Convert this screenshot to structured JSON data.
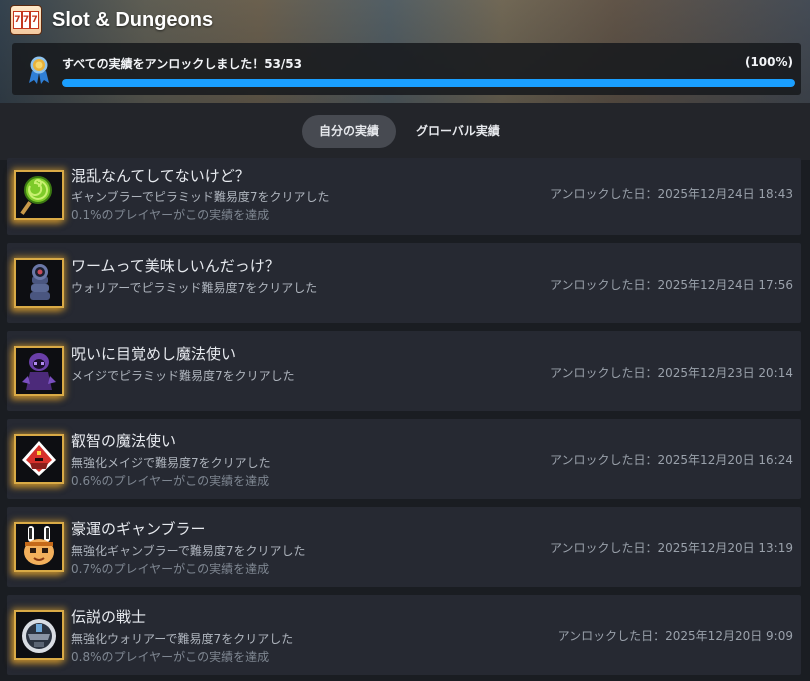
{
  "game": {
    "title": "Slot & Dungeons",
    "icon": "slot-machine-777-icon",
    "icon_reels": [
      "7",
      "7",
      "7"
    ]
  },
  "progress": {
    "label": "すべての実績をアンロックしました！53/53",
    "percent_text": "(100%)",
    "fraction": 1.0,
    "icon": "medal-icon",
    "accent": "#1a9fff"
  },
  "tabs": [
    {
      "label": "自分の実績",
      "active": true
    },
    {
      "label": "グローバル実績",
      "active": false
    }
  ],
  "achievements": [
    {
      "title": "混乱なんてしてないけど？",
      "description": "ギャンブラーでピラミッド難易度7をクリアした",
      "rarity": "0.1%のプレイヤーがこの実績を達成",
      "unlocked": "アンロックした日：2025年12月24日 18:43",
      "icon": "green-lollipop-icon"
    },
    {
      "title": "ワームって美味しいんだっけ？",
      "description": "ウォリアーでピラミッド難易度7をクリアした",
      "rarity": "",
      "unlocked": "アンロックした日：2025年12月24日 17:56",
      "icon": "worm-icon"
    },
    {
      "title": "呪いに目覚めし魔法使い",
      "description": "メイジでピラミッド難易度7をクリアした",
      "rarity": "",
      "unlocked": "アンロックした日：2025年12月23日 20:14",
      "icon": "cursed-mage-icon"
    },
    {
      "title": "叡智の魔法使い",
      "description": "無強化メイジで難易度7をクリアした",
      "rarity": "0.6%のプレイヤーがこの実績を達成",
      "unlocked": "アンロックした日：2025年12月20日 16:24",
      "icon": "wizard-hat-icon"
    },
    {
      "title": "豪運のギャンブラー",
      "description": "無強化ギャンブラーで難易度7をクリアした",
      "rarity": "0.7%のプレイヤーがこの実績を達成",
      "unlocked": "アンロックした日：2025年12月20日 13:19",
      "icon": "bunny-gambler-icon"
    },
    {
      "title": "伝説の戦士",
      "description": "無強化ウォリアーで難易度7をクリアした",
      "rarity": "0.8%のプレイヤーがこの実績を達成",
      "unlocked": "アンロックした日：2025年12月20日 9:09",
      "icon": "knight-helmet-icon"
    }
  ]
}
